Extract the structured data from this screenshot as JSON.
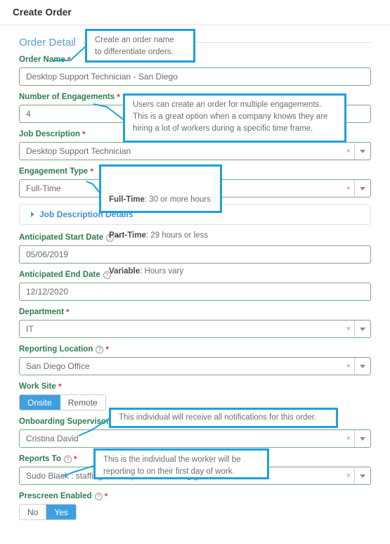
{
  "window": {
    "title": "Create Order"
  },
  "section": {
    "title": "Order Detail"
  },
  "icons": {
    "help": "?",
    "required": "*",
    "clear": "×"
  },
  "fields": [
    {
      "key": "order_name",
      "label": "Order Name",
      "required": true,
      "help": false,
      "type": "text",
      "value": "Desktop Support Technician - San Diego"
    },
    {
      "key": "number_of_engagements",
      "label": "Number of Engagements",
      "required": true,
      "help": false,
      "type": "text",
      "value": "4"
    },
    {
      "key": "job_description",
      "label": "Job Description",
      "required": true,
      "help": false,
      "type": "select",
      "value": "Desktop Support Technician"
    },
    {
      "key": "engagement_type",
      "label": "Engagement Type",
      "required": true,
      "help": false,
      "type": "select",
      "value": "Full-Time"
    },
    {
      "key": "anticipated_start_date",
      "label": "Anticipated Start Date",
      "required": true,
      "help": true,
      "type": "text",
      "value": "05/06/2019"
    },
    {
      "key": "anticipated_end_date",
      "label": "Anticipated End Date",
      "required": false,
      "help": true,
      "type": "text",
      "value": "12/12/2020"
    },
    {
      "key": "department",
      "label": "Department",
      "required": true,
      "help": false,
      "type": "select",
      "value": "IT"
    },
    {
      "key": "reporting_location",
      "label": "Reporting Location",
      "required": true,
      "help": true,
      "type": "select",
      "value": "San Diego Office"
    },
    {
      "key": "work_site",
      "label": "Work Site",
      "required": true,
      "help": false,
      "type": "toggle",
      "options": [
        "Onsite",
        "Remote"
      ],
      "value": "Onsite"
    },
    {
      "key": "onboarding_supervisor",
      "label": "Onboarding Supervisor",
      "required": true,
      "help": true,
      "type": "select",
      "value": "Cristina David"
    },
    {
      "key": "reports_to",
      "label": "Reports To",
      "required": true,
      "help": true,
      "type": "select",
      "value": "Sudo Black : staffingnation.qa1+sudoblack@gmail.com"
    },
    {
      "key": "prescreen_enabled",
      "label": "Prescreen Enabled",
      "required": true,
      "help": true,
      "type": "toggle",
      "options": [
        "No",
        "Yes"
      ],
      "value": "Yes"
    }
  ],
  "accordion": {
    "label": "Job Description Details"
  },
  "callouts": [
    {
      "key": "order-name-callout",
      "text": "Create an order name\nto differentiate orders."
    },
    {
      "key": "engagements-callout",
      "text": "Users can create an order for multiple engagements.\nThis is a great option when a company knows they are\nhiring a lot of workers during a specific time frame."
    },
    {
      "key": "engagement-type-callout",
      "lines": [
        {
          "bold": "Full-Time",
          "rest": ": 30 or more hours"
        },
        {
          "bold": "Part-Time",
          "rest": ": 29 hours or less"
        },
        {
          "bold": "Variable",
          "rest": ": Hours vary"
        }
      ]
    },
    {
      "key": "onboarding-supervisor-callout",
      "text": "This individual will receive all notifications for this order."
    },
    {
      "key": "reports-to-callout",
      "text": "This is the individual the worker will be\nreporting to on their first day of work."
    }
  ],
  "colors": {
    "accent_blue": "#1ba1de",
    "section_title": "#5b9bd5",
    "label_green": "#2e7d4f",
    "field_border": "#7aa87f",
    "required_red": "#e03b32",
    "toggle_on": "#3f9fe0",
    "link_blue": "#3e8fcd"
  }
}
